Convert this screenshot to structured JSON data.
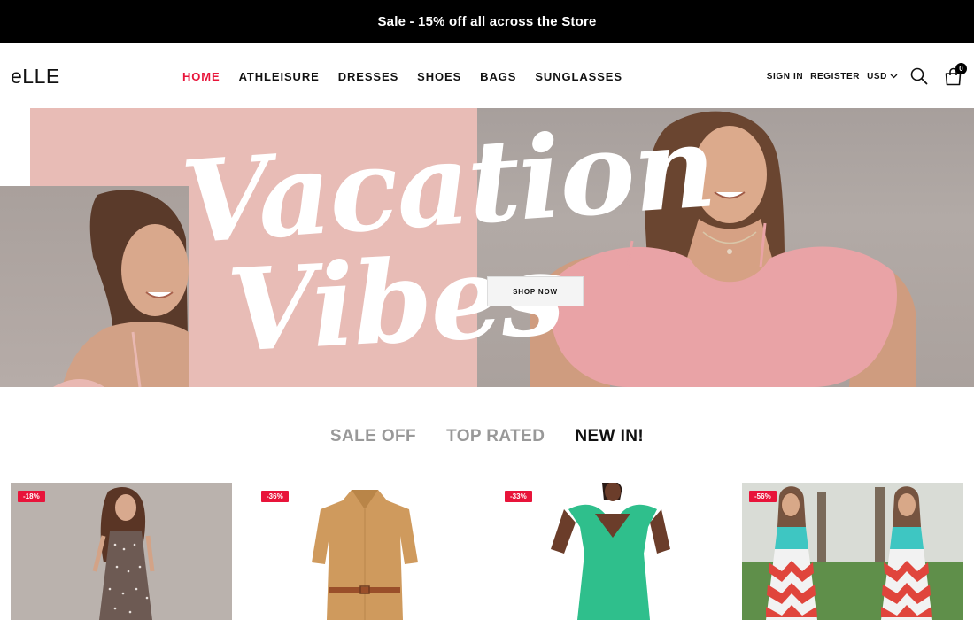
{
  "announcement": "Sale - 15% off all across the Store",
  "header": {
    "logo": "eLLE",
    "nav": [
      "HOME",
      "ATHLEISURE",
      "DRESSES",
      "SHOES",
      "BAGS",
      "SUNGLASSES"
    ],
    "sign_in": "SIGN IN",
    "register": "REGISTER",
    "currency": "USD",
    "cart_count": "0",
    "accent_color": "#e8143a"
  },
  "hero": {
    "title_line1": "Vacation",
    "title_line2": "Vibes",
    "cta": "SHOP NOW"
  },
  "tabs": [
    {
      "label": "SALE OFF",
      "active": false
    },
    {
      "label": "TOP RATED",
      "active": false
    },
    {
      "label": "NEW IN!",
      "active": true
    }
  ],
  "products": [
    {
      "discount": "-18%"
    },
    {
      "discount": "-36%"
    },
    {
      "discount": "-33%"
    },
    {
      "discount": "-56%"
    }
  ],
  "colors": {
    "announcement_bg": "#000000",
    "hero_pink": "#e8bcb6",
    "badge": "#e8143a"
  }
}
